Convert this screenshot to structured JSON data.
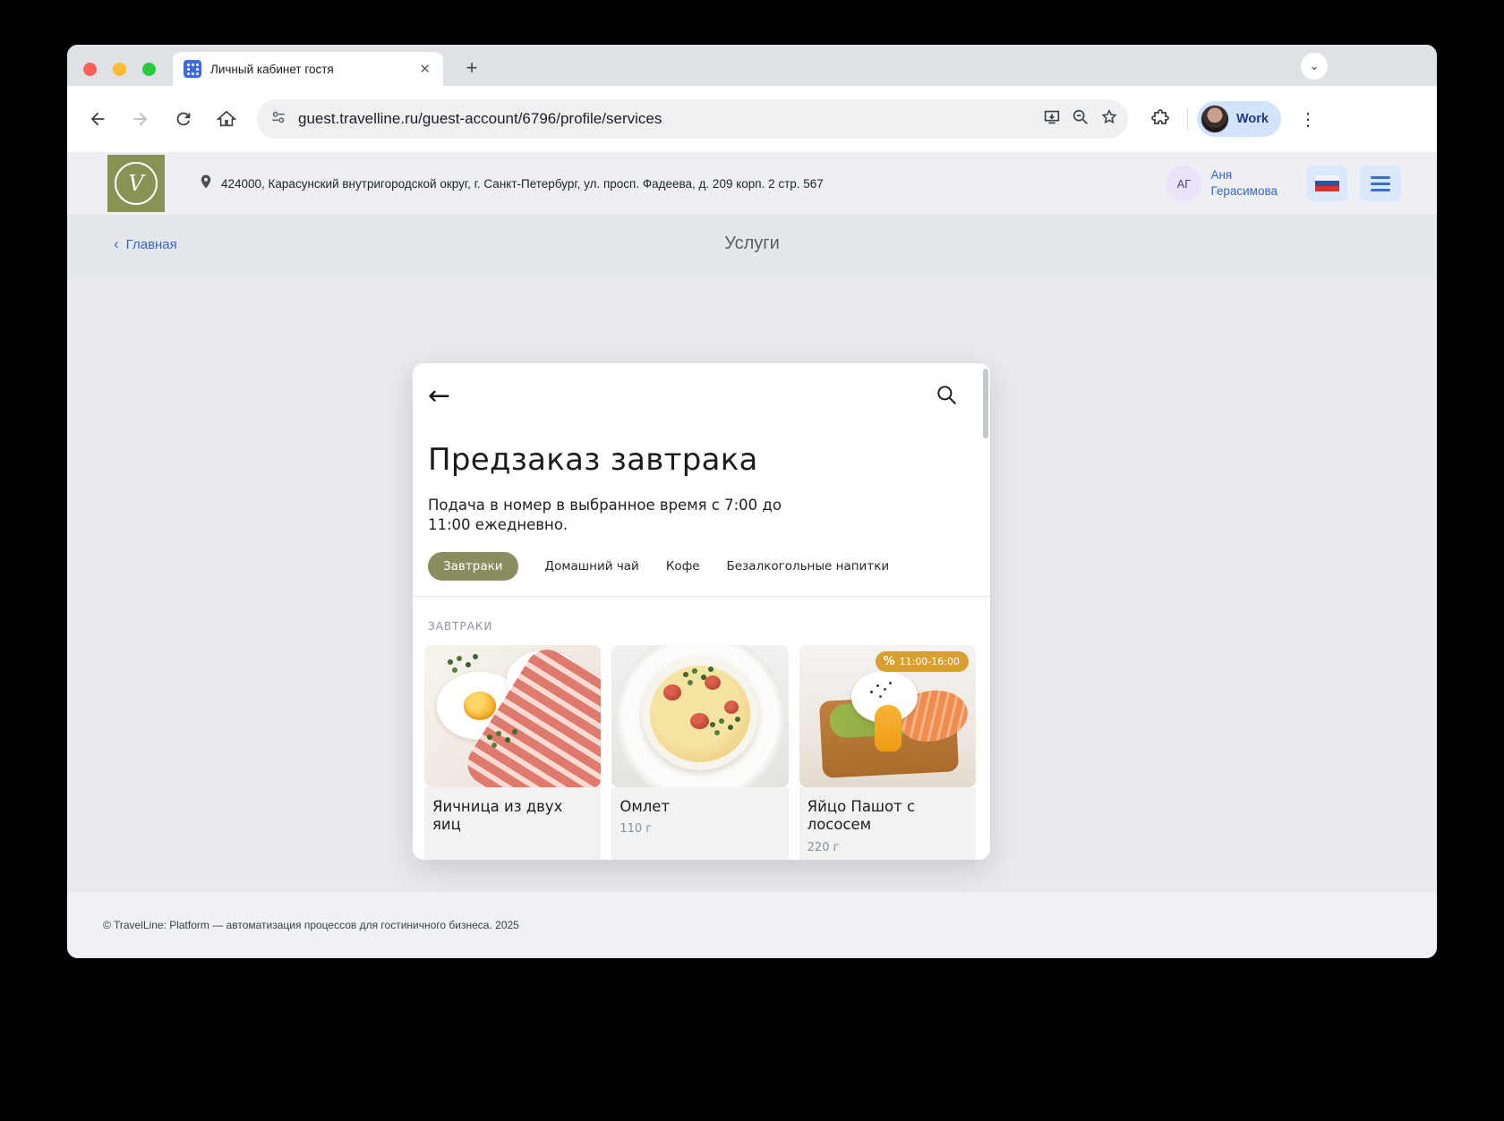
{
  "browser": {
    "tab_title": "Личный кабинет гостя",
    "new_tab_glyph": "+",
    "close_glyph": "✕",
    "tab_search_glyph": "⌄",
    "url": "guest.travelline.ru/guest-account/6796/profile/services",
    "profile_label": "Work",
    "menu_glyph": "⋮"
  },
  "site_header": {
    "address": "424000, Карасунский внутригородской округ, г. Санкт-Петербург, ул. просп. Фадеева, д. 209 корп. 2 стр. 567",
    "user_initials": "АГ",
    "user_name_line1": "Аня",
    "user_name_line2": "Герасимова",
    "logo_glyph": "V"
  },
  "nav_band": {
    "back_chevron": "‹",
    "back_label": "Главная",
    "page_title": "Услуги"
  },
  "modal": {
    "back_arrow": "←",
    "title": "Предзаказ завтрака",
    "description": "Подача в номер в выбранное время с 7:00 до 11:00 ежедневно.",
    "tabs": [
      "Завтраки",
      "Домашний чай",
      "Кофе",
      "Безалкогольные напитки"
    ],
    "section_label": "ЗАВТРАКИ",
    "items": [
      {
        "title": "Яичница из двух яиц",
        "weight": ""
      },
      {
        "title": "Омлет",
        "weight": "110 г"
      },
      {
        "title": "Яйцо Пашот с лососем",
        "weight": "220 г"
      }
    ],
    "badge": {
      "percent": "%",
      "range": "11:00-16:00"
    }
  },
  "footer": {
    "copyright": "© TravelLine: Platform — автоматизация процессов для гостиничного бизнеса. 2025"
  },
  "colors": {
    "accent_olive": "#8b8d60",
    "logo_olive": "#8a9154",
    "badge_gold": "#d8a02f",
    "link_blue": "#3567cf",
    "chip_blue": "#d3e3fd"
  }
}
